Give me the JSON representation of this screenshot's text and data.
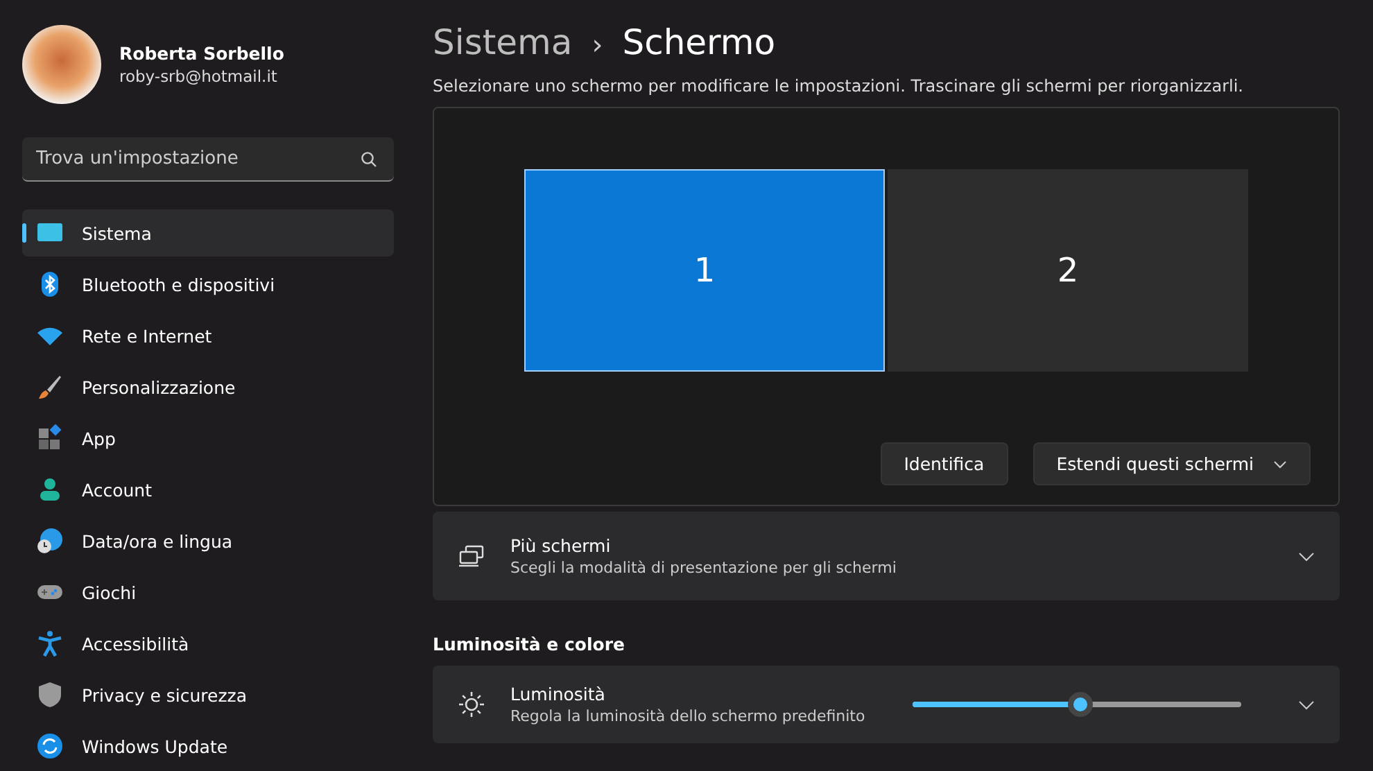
{
  "user": {
    "name": "Roberta Sorbello",
    "email": "roby-srb@hotmail.it"
  },
  "search": {
    "placeholder": "Trova un'impostazione"
  },
  "sidebar": {
    "items": [
      {
        "label": "Sistema",
        "kind": "system",
        "selected": true
      },
      {
        "label": "Bluetooth e dispositivi",
        "kind": "bluetooth",
        "selected": false
      },
      {
        "label": "Rete e Internet",
        "kind": "wifi",
        "selected": false
      },
      {
        "label": "Personalizzazione",
        "kind": "brush",
        "selected": false
      },
      {
        "label": "App",
        "kind": "apps",
        "selected": false
      },
      {
        "label": "Account",
        "kind": "person",
        "selected": false
      },
      {
        "label": "Data/ora e lingua",
        "kind": "clock",
        "selected": false
      },
      {
        "label": "Giochi",
        "kind": "gamepad",
        "selected": false
      },
      {
        "label": "Accessibilità",
        "kind": "access",
        "selected": false
      },
      {
        "label": "Privacy e sicurezza",
        "kind": "shield",
        "selected": false
      },
      {
        "label": "Windows Update",
        "kind": "update",
        "selected": false
      }
    ]
  },
  "breadcrumb": {
    "parent": "Sistema",
    "separator": "›",
    "current": "Schermo"
  },
  "instructions": "Selezionare uno schermo per modificare le impostazioni. Trascinare gli schermi per riorganizzarli.",
  "monitors": [
    {
      "label": "1",
      "selected": true
    },
    {
      "label": "2",
      "selected": false
    }
  ],
  "arrangement_buttons": {
    "identify": "Identifica",
    "extend": "Estendi questi schermi"
  },
  "multi_display": {
    "title": "Più schermi",
    "subtitle": "Scegli la modalità di presentazione per gli schermi"
  },
  "section_heading": "Luminosità e colore",
  "brightness": {
    "title": "Luminosità",
    "subtitle": "Regola la luminosità dello schermo predefinito",
    "level": 0.51
  }
}
